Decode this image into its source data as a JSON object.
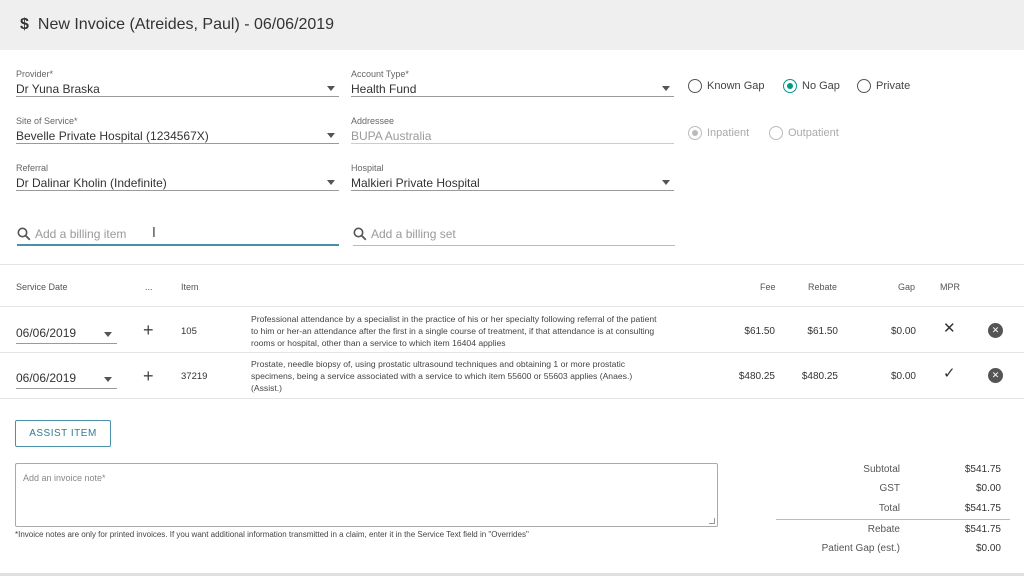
{
  "header": {
    "title": "New Invoice (Atreides, Paul) - 06/06/2019",
    "icon": "dollar-icon"
  },
  "form": {
    "provider": {
      "label": "Provider*",
      "value": "Dr Yuna Braska"
    },
    "account_type": {
      "label": "Account Type*",
      "value": "Health Fund"
    },
    "gap_options": [
      {
        "label": "Known Gap",
        "selected": false
      },
      {
        "label": "No Gap",
        "selected": true
      },
      {
        "label": "Private",
        "selected": false
      }
    ],
    "site_of_service": {
      "label": "Site of Service*",
      "value": "Bevelle Private Hospital (1234567X)"
    },
    "addressee": {
      "label": "Addressee",
      "value": "BUPA Australia"
    },
    "patient_type": [
      {
        "label": "Inpatient",
        "selected": true
      },
      {
        "label": "Outpatient",
        "selected": false
      }
    ],
    "referral": {
      "label": "Referral",
      "value": "Dr Dalinar Kholin (Indefinite)"
    },
    "hospital": {
      "label": "Hospital",
      "value": "Malkieri Private Hospital"
    },
    "billing_item_search": {
      "placeholder": "Add a billing item"
    },
    "billing_set_search": {
      "placeholder": "Add a billing set"
    }
  },
  "table": {
    "headers": {
      "service_date": "Service Date",
      "more": "...",
      "item": "Item",
      "fee": "Fee",
      "rebate": "Rebate",
      "gap": "Gap",
      "mpr": "MPR"
    },
    "rows": [
      {
        "date": "06/06/2019",
        "item": "105",
        "description": "Professional attendance by a specialist in the practice of his or her specialty following referral of the patient to him or her-an attendance after the first in a single course of treatment, if that attendance is at consulting rooms or hospital, other than a service to which item 16404 applies",
        "fee": "$61.50",
        "rebate": "$61.50",
        "gap": "$0.00",
        "mpr": "✕"
      },
      {
        "date": "06/06/2019",
        "item": "37219",
        "description": "Prostate, needle biopsy of, using prostatic ultrasound techniques and obtaining 1 or more prostatic specimens, being a service associated with a service to which item 55600 or 55603 applies (Anaes.) (Assist.)",
        "fee": "$480.25",
        "rebate": "$480.25",
        "gap": "$0.00",
        "mpr": "✓"
      }
    ]
  },
  "assist_button": {
    "label": "ASSIST ITEM"
  },
  "invoice_note": {
    "placeholder": "Add an invoice note*",
    "help": "*Invoice notes are only for printed invoices. If you want additional information transmitted in a claim, enter it in the Service Text field in \"Overrides\""
  },
  "totals": {
    "subtotal": {
      "label": "Subtotal",
      "value": "$541.75"
    },
    "gst": {
      "label": "GST",
      "value": "$0.00"
    },
    "total": {
      "label": "Total",
      "value": "$541.75"
    },
    "rebate": {
      "label": "Rebate",
      "value": "$541.75"
    },
    "patient_gap": {
      "label": "Patient Gap (est.)",
      "value": "$0.00"
    }
  },
  "colors": {
    "accent": "#009688",
    "focus": "#4a90a8"
  }
}
